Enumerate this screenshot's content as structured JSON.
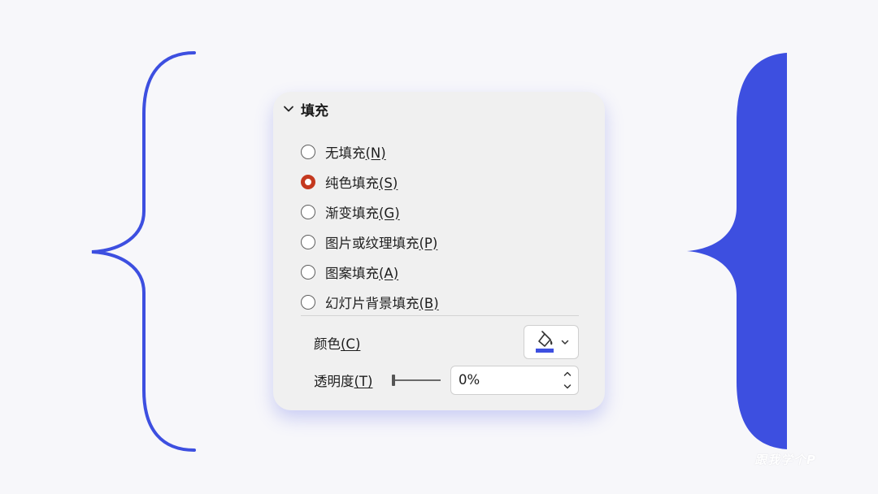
{
  "colors": {
    "accent_blue": "#3d4fe0",
    "radio_selected": "#c4391f",
    "panel_bg": "#f0f0f0",
    "page_bg": "#f7f7fa"
  },
  "panel": {
    "section_title": "填充",
    "section_icon": "chevron-down-icon",
    "fill_options": [
      {
        "label": "无填充",
        "accelerator": "(N)",
        "selected": false
      },
      {
        "label": "纯色填充",
        "accelerator": "(S)",
        "selected": true
      },
      {
        "label": "渐变填充",
        "accelerator": "(G)",
        "selected": false
      },
      {
        "label": "图片或纹理填充",
        "accelerator": "(P)",
        "selected": false
      },
      {
        "label": "图案填充",
        "accelerator": "(A)",
        "selected": false
      },
      {
        "label": "幻灯片背景填充",
        "accelerator": "(B)",
        "selected": false
      }
    ],
    "color": {
      "label": "颜色",
      "accelerator": "(C)",
      "icon": "paint-bucket-icon",
      "swatch": "#3d4fe0"
    },
    "transparency": {
      "label": "透明度",
      "accelerator": "(T)",
      "value": "0%",
      "slider_fraction": 0
    }
  },
  "watermark": "跟我学个P"
}
